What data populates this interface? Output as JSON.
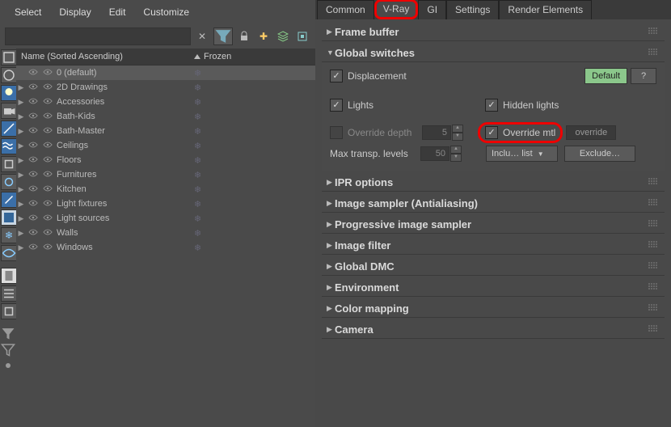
{
  "menu": {
    "select": "Select",
    "display": "Display",
    "edit": "Edit",
    "customize": "Customize"
  },
  "layer_panel": {
    "col_name": "Name (Sorted Ascending)",
    "col_frozen": "Frozen",
    "layers": [
      {
        "name": "0 (default)",
        "expandable": false
      },
      {
        "name": "2D Drawings",
        "expandable": true
      },
      {
        "name": "Accessories",
        "expandable": true
      },
      {
        "name": "Bath-Kids",
        "expandable": true
      },
      {
        "name": "Bath-Master",
        "expandable": true
      },
      {
        "name": "Ceilings",
        "expandable": true
      },
      {
        "name": "Floors",
        "expandable": true
      },
      {
        "name": "Furnitures",
        "expandable": true
      },
      {
        "name": "Kitchen",
        "expandable": true
      },
      {
        "name": "Light fixtures",
        "expandable": true
      },
      {
        "name": "Light sources",
        "expandable": true
      },
      {
        "name": "Walls",
        "expandable": true
      },
      {
        "name": "Windows",
        "expandable": true
      }
    ]
  },
  "tabs": {
    "common": "Common",
    "vray": "V-Ray",
    "gi": "GI",
    "settings": "Settings",
    "render_elements": "Render Elements"
  },
  "rollouts": {
    "frame_buffer": "Frame buffer",
    "global_switches": {
      "title": "Global switches",
      "displacement": "Displacement",
      "default_btn": "Default",
      "help": "?",
      "lights": "Lights",
      "hidden_lights": "Hidden lights",
      "override_depth": "Override depth",
      "override_depth_val": "5",
      "override_mtl": "Override mtl",
      "override_slot": "override",
      "max_transp": "Max transp. levels",
      "max_transp_val": "50",
      "include_list": "Inclu… list",
      "exclude": "Exclude…"
    },
    "ipr": "IPR options",
    "image_sampler": "Image sampler (Antialiasing)",
    "progressive": "Progressive image sampler",
    "image_filter": "Image filter",
    "global_dmc": "Global DMC",
    "environment": "Environment",
    "color_mapping": "Color mapping",
    "camera": "Camera"
  }
}
